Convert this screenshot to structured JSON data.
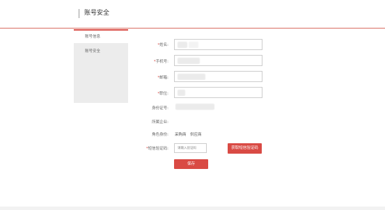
{
  "header": {
    "title": "账号安全"
  },
  "sidebar": {
    "items": [
      {
        "label": "账号信息",
        "active": true
      },
      {
        "label": "账号安全",
        "active": false
      }
    ]
  },
  "form": {
    "name": {
      "required_mark": "*",
      "label": "姓名:"
    },
    "phone": {
      "required_mark": "*",
      "label": "手机号:"
    },
    "email": {
      "required_mark": "*",
      "label": "邮箱:"
    },
    "position": {
      "required_mark": "*",
      "label": "职位:"
    },
    "id_card": {
      "label": "身份证号:"
    },
    "company": {
      "label": "所属企业:"
    },
    "role": {
      "label": "角色身份:",
      "values": [
        "采购商",
        "供应商"
      ]
    },
    "sms": {
      "required_mark": "*",
      "label": "短信验证码:",
      "placeholder": "请输入验证码",
      "get_code_label": "获取短信验证码"
    },
    "save_label": "保存"
  },
  "colors": {
    "accent": "#d94a44",
    "header_line": "#d96a5f"
  }
}
